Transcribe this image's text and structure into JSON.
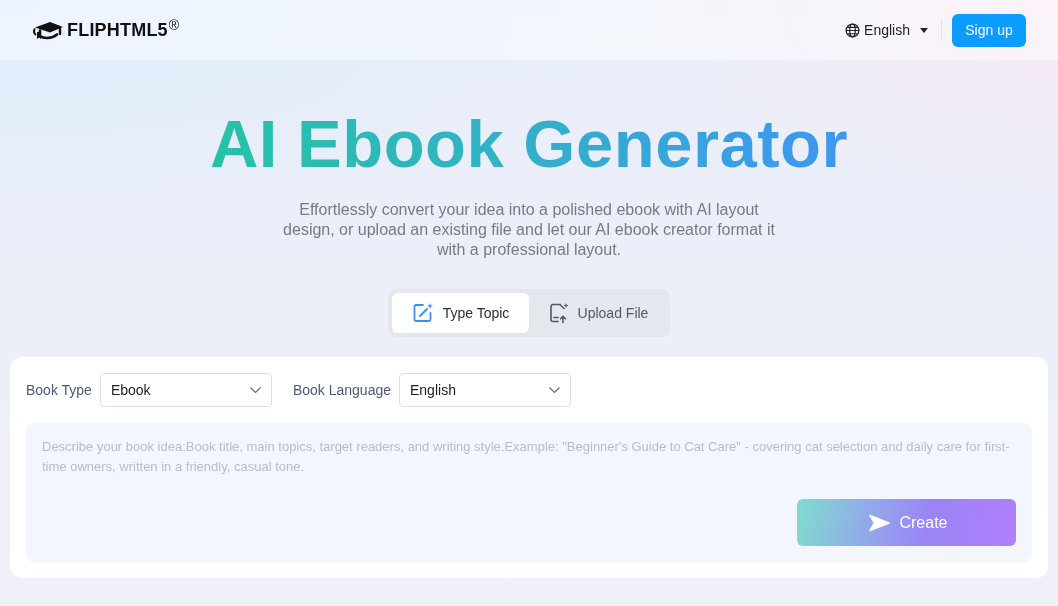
{
  "header": {
    "logo": "FLIPHTML5$^{®}$",
    "language": "English",
    "signup": "Sign up"
  },
  "hero": {
    "title": "AI Ebook Generator",
    "subtitle": "Effortlessly convert your idea into a polished ebook with AI layout design, or upload an existing file and let our AI ebook creator format it with a professional layout."
  },
  "tabs": [
    {
      "label": "Type Topic",
      "kind": "topic",
      "selected": true
    },
    {
      "label": "Upload File",
      "kind": "upload",
      "selected": false
    }
  ],
  "form": {
    "fields": [
      {
        "label": "Book Type",
        "value": "Ebook"
      },
      {
        "label": "Book Language",
        "value": "English"
      }
    ],
    "prompt": {
      "placeholder": "Describe your book idea:Book title, main topics, target readers, and writing style.Example: \"Beginner's Guide to Cat Care\" - covering cat selection and daily care for first-time owners, written in a friendly, casual tone."
    },
    "create_button": "Create"
  }
}
